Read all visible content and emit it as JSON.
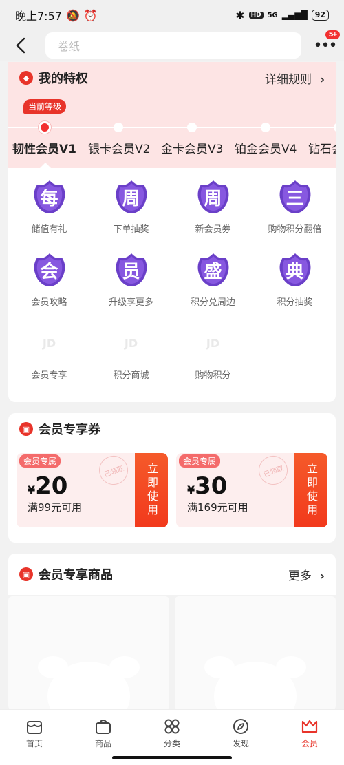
{
  "status": {
    "time": "晚上7:57",
    "battery": "92",
    "network": "5G",
    "hd": "HD"
  },
  "header": {
    "search_placeholder": "卷纸",
    "more_badge": "5+"
  },
  "privileges": {
    "title": "我的特权",
    "rules_link": "详细规则",
    "current_tag": "当前等级",
    "levels": [
      "韧性会员V1",
      "银卡会员V2",
      "金卡会员V3",
      "铂金会员V4",
      "钻石会"
    ],
    "items": [
      {
        "glyph": "每",
        "label": "储值有礼"
      },
      {
        "glyph": "周",
        "label": "下单抽奖"
      },
      {
        "glyph": "周",
        "label": "新会员券"
      },
      {
        "glyph": "三",
        "label": "购物积分翻倍"
      },
      {
        "glyph": "会",
        "label": "会员攻略"
      },
      {
        "glyph": "员",
        "label": "升级享更多"
      },
      {
        "glyph": "盛",
        "label": "积分兑周边"
      },
      {
        "glyph": "典",
        "label": "积分抽奖"
      },
      {
        "glyph": "JD",
        "label": "会员专享"
      },
      {
        "glyph": "JD",
        "label": "积分商城"
      },
      {
        "glyph": "JD",
        "label": "购物积分"
      }
    ]
  },
  "coupons": {
    "title": "会员专享券",
    "list": [
      {
        "tag": "会员专属",
        "currency": "¥",
        "amount": "20",
        "condition": "满99元可用",
        "stamp": "已领取",
        "button": "立即使用"
      },
      {
        "tag": "会员专属",
        "currency": "¥",
        "amount": "30",
        "condition": "满169元可用",
        "stamp": "已领取",
        "button": "立即使用"
      }
    ]
  },
  "products": {
    "title": "会员专享商品",
    "more": "更多"
  },
  "tabs": [
    {
      "label": "首页",
      "icon": "store-icon"
    },
    {
      "label": "商品",
      "icon": "bag-icon"
    },
    {
      "label": "分类",
      "icon": "grid-icon"
    },
    {
      "label": "发现",
      "icon": "compass-icon"
    },
    {
      "label": "会员",
      "icon": "crown-icon"
    }
  ],
  "colors": {
    "accent": "#e8342a",
    "badge_purple": "#6a3fc8",
    "pink_bg": "#fde4e4"
  }
}
